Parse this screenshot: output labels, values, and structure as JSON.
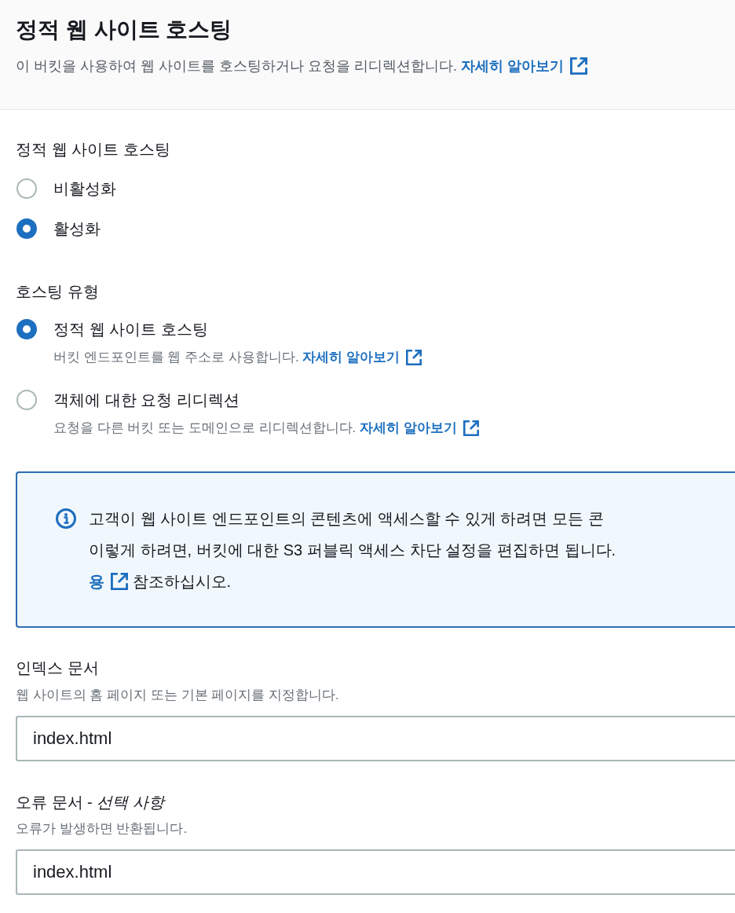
{
  "header": {
    "title": "정적 웹 사이트 호스팅",
    "description": "이 버킷을 사용하여 웹 사이트를 호스팅하거나 요청을 리디렉션합니다.",
    "link": "자세히 알아보기"
  },
  "hosting": {
    "label": "정적 웹 사이트 호스팅",
    "options": [
      {
        "label": "비활성화",
        "selected": false
      },
      {
        "label": "활성화",
        "selected": true
      }
    ]
  },
  "hosting_type": {
    "label": "호스팅 유형",
    "options": [
      {
        "label": "정적 웹 사이트 호스팅",
        "description": "버킷 엔드포인트를 웹 주소로 사용합니다.",
        "link": "자세히 알아보기",
        "selected": true
      },
      {
        "label": "객체에 대한 요청 리디렉션",
        "description": "요청을 다른 버킷 또는 도메인으로 리디렉션합니다.",
        "link": "자세히 알아보기",
        "selected": false
      }
    ]
  },
  "info": {
    "lines": [
      "고객이 웹 사이트 엔드포인트의 콘텐츠에 액세스할 수 있게 하려면 모든 콘",
      "이렇게 하려면, 버킷에 대한 S3 퍼블릭 액세스 차단 설정을 편집하면 됩니다."
    ],
    "link": "용",
    "after_link": "참조하십시오."
  },
  "fields": [
    {
      "label": "인덱스 문서",
      "description": "웹 사이트의 홈 페이지 또는 기본 페이지를 지정합니다.",
      "value": "index.html"
    },
    {
      "label": "오류 문서 - *선택 사항*",
      "description": "오류가 발생하면 반환됩니다.",
      "value": "index.html"
    }
  ]
}
